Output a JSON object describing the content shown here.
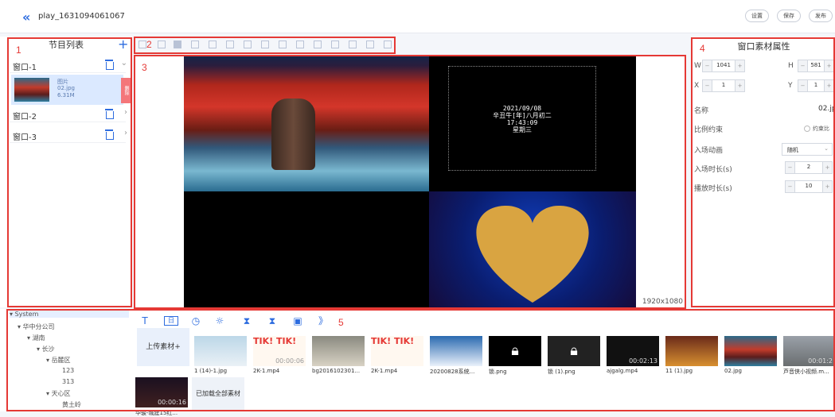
{
  "top": {
    "title": "play_1631094061067",
    "buttons": [
      "设置",
      "保存",
      "发布"
    ]
  },
  "left_panel": {
    "title": "节目列表",
    "windows": [
      {
        "label": "窗口-1",
        "expanded": true
      },
      {
        "label": "窗口-2",
        "expanded": false
      },
      {
        "label": "窗口-3",
        "expanded": false
      }
    ],
    "media_item": {
      "type": "图片",
      "name": "02.jpg",
      "size": "6.31M",
      "delete": "删除"
    }
  },
  "canvas": {
    "clock_lines": [
      "2021/09/08",
      "辛丑牛[年]八月初二",
      "17:43:09",
      "星期三"
    ],
    "resolution": "1920x1080"
  },
  "right_panel": {
    "title": "窗口素材属性",
    "w_label": "W",
    "w_value": "1041",
    "h_label": "H",
    "h_value": "581",
    "x_label": "X",
    "x_value": "1",
    "y_label": "Y",
    "y_value": "1",
    "name_label": "名称",
    "name_value": "02.jp",
    "ratio_label": "比例约束",
    "ratio_check": "约束比",
    "anim_label": "入场动画",
    "anim_value": "随机",
    "anim_dur_label": "入场时长(s)",
    "anim_dur_value": "2",
    "play_dur_label": "播放时长(s)",
    "play_dur_value": "10"
  },
  "tree": {
    "nodes": [
      {
        "label": "System"
      },
      {
        "label": "华中分公司"
      },
      {
        "label": "湖南"
      },
      {
        "label": "长沙"
      },
      {
        "label": "岳麓区"
      },
      {
        "label": "123"
      },
      {
        "label": "313"
      },
      {
        "label": "天心区"
      },
      {
        "label": "黄土岭"
      }
    ]
  },
  "assets": {
    "upload_label": "上传素材+",
    "loaded_all": "已加载全部素材",
    "items": [
      {
        "name": "1 (14)-1.jpg",
        "duration": ""
      },
      {
        "name": "2K-1.mp4",
        "duration": "00:00:06"
      },
      {
        "name": "bg2016102301...",
        "duration": ""
      },
      {
        "name": "2K-1.mp4",
        "duration": ""
      },
      {
        "name": "20200828系统...",
        "duration": ""
      },
      {
        "name": "锁.png",
        "duration": ""
      },
      {
        "name": "锁 (1).png",
        "duration": ""
      },
      {
        "name": "ajgalg.mp4",
        "duration": "00:02:13"
      },
      {
        "name": "11 (1).jpg",
        "duration": ""
      },
      {
        "name": "02.jpg",
        "duration": ""
      },
      {
        "name": "芦音侠小视频.m...",
        "duration": "00:01:2"
      },
      {
        "name": "华骏-城建15红...",
        "duration": "00:00:16"
      }
    ],
    "tik_text": "TIK! TIK!"
  },
  "region_numbers": [
    "1",
    "2",
    "3",
    "4",
    "5"
  ],
  "colors": {
    "accent": "#2d6cdf",
    "annotation": "#e53935"
  }
}
